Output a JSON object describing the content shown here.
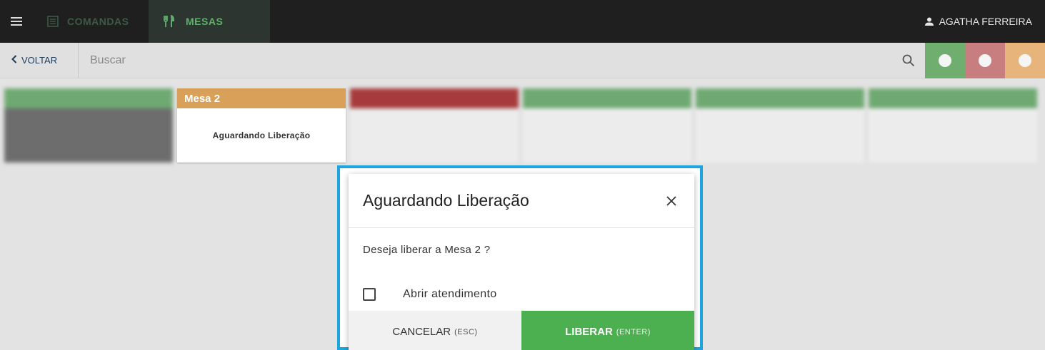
{
  "topbar": {
    "tabs": [
      {
        "label": "COMANDAS",
        "icon": "list-icon"
      },
      {
        "label": "MESAS",
        "icon": "fork-knife-icon"
      }
    ],
    "user": "AGATHA FERREIRA"
  },
  "searchbar": {
    "back_label": "VOLTAR",
    "placeholder": "Buscar",
    "filters": [
      {
        "color": "#6fae6f"
      },
      {
        "color": "#c87e7e"
      },
      {
        "color": "#e7b57c"
      }
    ]
  },
  "cards": [
    {
      "title": "Mesa 2",
      "body": "Aguardando Liberação"
    }
  ],
  "modal": {
    "title": "Aguardando Liberação",
    "question": "Deseja liberar a Mesa 2 ?",
    "checkbox_label": "Abrir atendimento",
    "cancel_label": "CANCELAR",
    "cancel_hint": "(ESC)",
    "confirm_label": "LIBERAR",
    "confirm_hint": "(ENTER)"
  },
  "colors": {
    "accent_green": "#4caf50",
    "frame_blue": "#1ba7de",
    "status_pending": "#d9a05a"
  }
}
